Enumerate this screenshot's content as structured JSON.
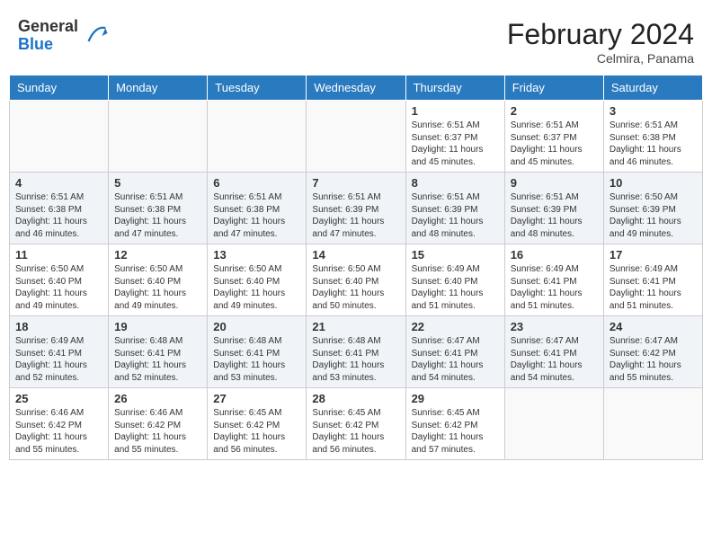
{
  "header": {
    "logo": {
      "general": "General",
      "blue": "Blue"
    },
    "month_year": "February 2024",
    "location": "Celmira, Panama"
  },
  "days_of_week": [
    "Sunday",
    "Monday",
    "Tuesday",
    "Wednesday",
    "Thursday",
    "Friday",
    "Saturday"
  ],
  "weeks": [
    [
      {
        "day": "",
        "empty": true
      },
      {
        "day": "",
        "empty": true
      },
      {
        "day": "",
        "empty": true
      },
      {
        "day": "",
        "empty": true
      },
      {
        "day": "1",
        "sunrise": "6:51 AM",
        "sunset": "6:37 PM",
        "daylight": "11 hours and 45 minutes."
      },
      {
        "day": "2",
        "sunrise": "6:51 AM",
        "sunset": "6:37 PM",
        "daylight": "11 hours and 45 minutes."
      },
      {
        "day": "3",
        "sunrise": "6:51 AM",
        "sunset": "6:38 PM",
        "daylight": "11 hours and 46 minutes."
      }
    ],
    [
      {
        "day": "4",
        "sunrise": "6:51 AM",
        "sunset": "6:38 PM",
        "daylight": "11 hours and 46 minutes."
      },
      {
        "day": "5",
        "sunrise": "6:51 AM",
        "sunset": "6:38 PM",
        "daylight": "11 hours and 47 minutes."
      },
      {
        "day": "6",
        "sunrise": "6:51 AM",
        "sunset": "6:38 PM",
        "daylight": "11 hours and 47 minutes."
      },
      {
        "day": "7",
        "sunrise": "6:51 AM",
        "sunset": "6:39 PM",
        "daylight": "11 hours and 47 minutes."
      },
      {
        "day": "8",
        "sunrise": "6:51 AM",
        "sunset": "6:39 PM",
        "daylight": "11 hours and 48 minutes."
      },
      {
        "day": "9",
        "sunrise": "6:51 AM",
        "sunset": "6:39 PM",
        "daylight": "11 hours and 48 minutes."
      },
      {
        "day": "10",
        "sunrise": "6:50 AM",
        "sunset": "6:39 PM",
        "daylight": "11 hours and 49 minutes."
      }
    ],
    [
      {
        "day": "11",
        "sunrise": "6:50 AM",
        "sunset": "6:40 PM",
        "daylight": "11 hours and 49 minutes."
      },
      {
        "day": "12",
        "sunrise": "6:50 AM",
        "sunset": "6:40 PM",
        "daylight": "11 hours and 49 minutes."
      },
      {
        "day": "13",
        "sunrise": "6:50 AM",
        "sunset": "6:40 PM",
        "daylight": "11 hours and 49 minutes."
      },
      {
        "day": "14",
        "sunrise": "6:50 AM",
        "sunset": "6:40 PM",
        "daylight": "11 hours and 50 minutes."
      },
      {
        "day": "15",
        "sunrise": "6:49 AM",
        "sunset": "6:40 PM",
        "daylight": "11 hours and 51 minutes."
      },
      {
        "day": "16",
        "sunrise": "6:49 AM",
        "sunset": "6:41 PM",
        "daylight": "11 hours and 51 minutes."
      },
      {
        "day": "17",
        "sunrise": "6:49 AM",
        "sunset": "6:41 PM",
        "daylight": "11 hours and 51 minutes."
      }
    ],
    [
      {
        "day": "18",
        "sunrise": "6:49 AM",
        "sunset": "6:41 PM",
        "daylight": "11 hours and 52 minutes."
      },
      {
        "day": "19",
        "sunrise": "6:48 AM",
        "sunset": "6:41 PM",
        "daylight": "11 hours and 52 minutes."
      },
      {
        "day": "20",
        "sunrise": "6:48 AM",
        "sunset": "6:41 PM",
        "daylight": "11 hours and 53 minutes."
      },
      {
        "day": "21",
        "sunrise": "6:48 AM",
        "sunset": "6:41 PM",
        "daylight": "11 hours and 53 minutes."
      },
      {
        "day": "22",
        "sunrise": "6:47 AM",
        "sunset": "6:41 PM",
        "daylight": "11 hours and 54 minutes."
      },
      {
        "day": "23",
        "sunrise": "6:47 AM",
        "sunset": "6:41 PM",
        "daylight": "11 hours and 54 minutes."
      },
      {
        "day": "24",
        "sunrise": "6:47 AM",
        "sunset": "6:42 PM",
        "daylight": "11 hours and 55 minutes."
      }
    ],
    [
      {
        "day": "25",
        "sunrise": "6:46 AM",
        "sunset": "6:42 PM",
        "daylight": "11 hours and 55 minutes."
      },
      {
        "day": "26",
        "sunrise": "6:46 AM",
        "sunset": "6:42 PM",
        "daylight": "11 hours and 55 minutes."
      },
      {
        "day": "27",
        "sunrise": "6:45 AM",
        "sunset": "6:42 PM",
        "daylight": "11 hours and 56 minutes."
      },
      {
        "day": "28",
        "sunrise": "6:45 AM",
        "sunset": "6:42 PM",
        "daylight": "11 hours and 56 minutes."
      },
      {
        "day": "29",
        "sunrise": "6:45 AM",
        "sunset": "6:42 PM",
        "daylight": "11 hours and 57 minutes."
      },
      {
        "day": "",
        "empty": true
      },
      {
        "day": "",
        "empty": true
      }
    ]
  ]
}
